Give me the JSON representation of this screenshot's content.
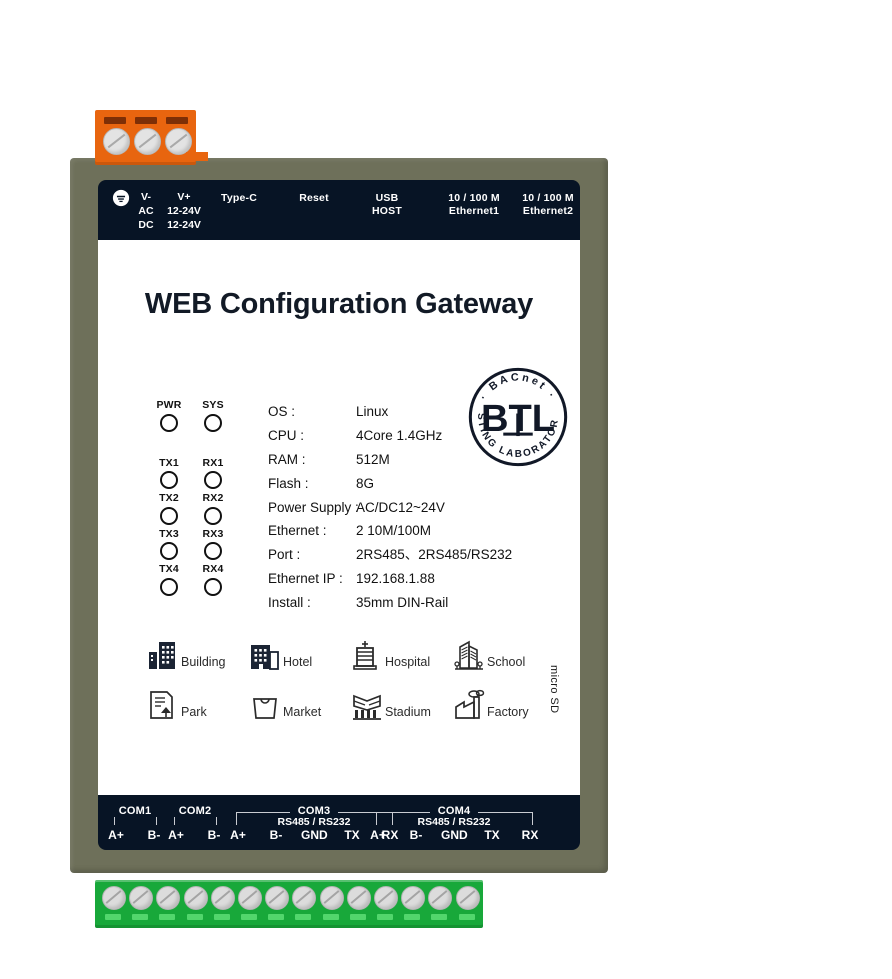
{
  "product": {
    "title": "WEB Configuration Gateway"
  },
  "top_connector": {
    "name": "3-pin power terminal block",
    "pins": 3,
    "color": "#e8650f"
  },
  "header": {
    "ground_icon": "earth-ground-icon",
    "power": {
      "row1": [
        "V-",
        "V+"
      ],
      "row2": [
        "AC",
        "12-24V"
      ],
      "row3": [
        "DC",
        "12-24V"
      ]
    },
    "ports": [
      {
        "line1": "Type-C",
        "line2": ""
      },
      {
        "line1": "Reset",
        "line2": ""
      },
      {
        "line1": "USB",
        "line2": "HOST"
      },
      {
        "line1": "10 / 100 M",
        "line2": "Ethernet1"
      },
      {
        "line1": "10 / 100 M",
        "line2": "Ethernet2"
      }
    ]
  },
  "leds": {
    "status": [
      {
        "left": "PWR",
        "right": "SYS"
      }
    ],
    "channels": [
      {
        "left": "TX1",
        "right": "RX1"
      },
      {
        "left": "TX2",
        "right": "RX2"
      },
      {
        "left": "TX3",
        "right": "RX3"
      },
      {
        "left": "TX4",
        "right": "RX4"
      }
    ]
  },
  "specs": [
    {
      "key": "OS :",
      "value": "Linux"
    },
    {
      "key": "CPU :",
      "value": "4Core 1.4GHz"
    },
    {
      "key": "RAM :",
      "value": "512M"
    },
    {
      "key": "Flash :",
      "value": "8G"
    },
    {
      "key": "Power Supply :",
      "value": "AC/DC12~24V"
    },
    {
      "key": "Ethernet :",
      "value": "2 10M/100M"
    },
    {
      "key": "Port :",
      "value": "2RS485、2RS485/RS232"
    },
    {
      "key": "Ethernet IP :",
      "value": "192.168.1.88"
    },
    {
      "key": "Install :",
      "value": "35mm DIN-Rail"
    }
  ],
  "certification": {
    "name": "btl-logo",
    "center_text": "BTL",
    "arc_top": "· BACnet ·",
    "arc_bottom": "TESTING LABORATORIES"
  },
  "applications": [
    {
      "label": "Building",
      "icon": "building-icon"
    },
    {
      "label": "Hotel",
      "icon": "hotel-icon"
    },
    {
      "label": "Hospital",
      "icon": "hospital-icon"
    },
    {
      "label": "School",
      "icon": "school-icon"
    },
    {
      "label": "Park",
      "icon": "park-icon"
    },
    {
      "label": "Market",
      "icon": "market-icon"
    },
    {
      "label": "Stadium",
      "icon": "stadium-icon"
    },
    {
      "label": "Factory",
      "icon": "factory-icon"
    }
  ],
  "micro_sd": {
    "label": "micro SD"
  },
  "bottom_ports": {
    "groups": [
      {
        "title": "COM1",
        "subtitle": "",
        "pins": [
          "A+",
          "B-"
        ]
      },
      {
        "title": "COM2",
        "subtitle": "",
        "pins": [
          "A+",
          "B-"
        ]
      },
      {
        "title": "COM3",
        "subtitle": "RS485 / RS232",
        "pins": [
          "A+",
          "B-",
          "GND",
          "TX",
          "RX"
        ]
      },
      {
        "title": "COM4",
        "subtitle": "RS485 / RS232",
        "pins": [
          "A+",
          "B-",
          "GND",
          "TX",
          "RX"
        ]
      }
    ]
  },
  "bottom_connector": {
    "name": "14-pin terminal block",
    "pins": 14,
    "color": "#18a83a"
  },
  "colors": {
    "case": "#6e705a",
    "panel": "#ffffff",
    "strip": "#071425",
    "orange": "#e8650f",
    "green": "#18a83a"
  }
}
